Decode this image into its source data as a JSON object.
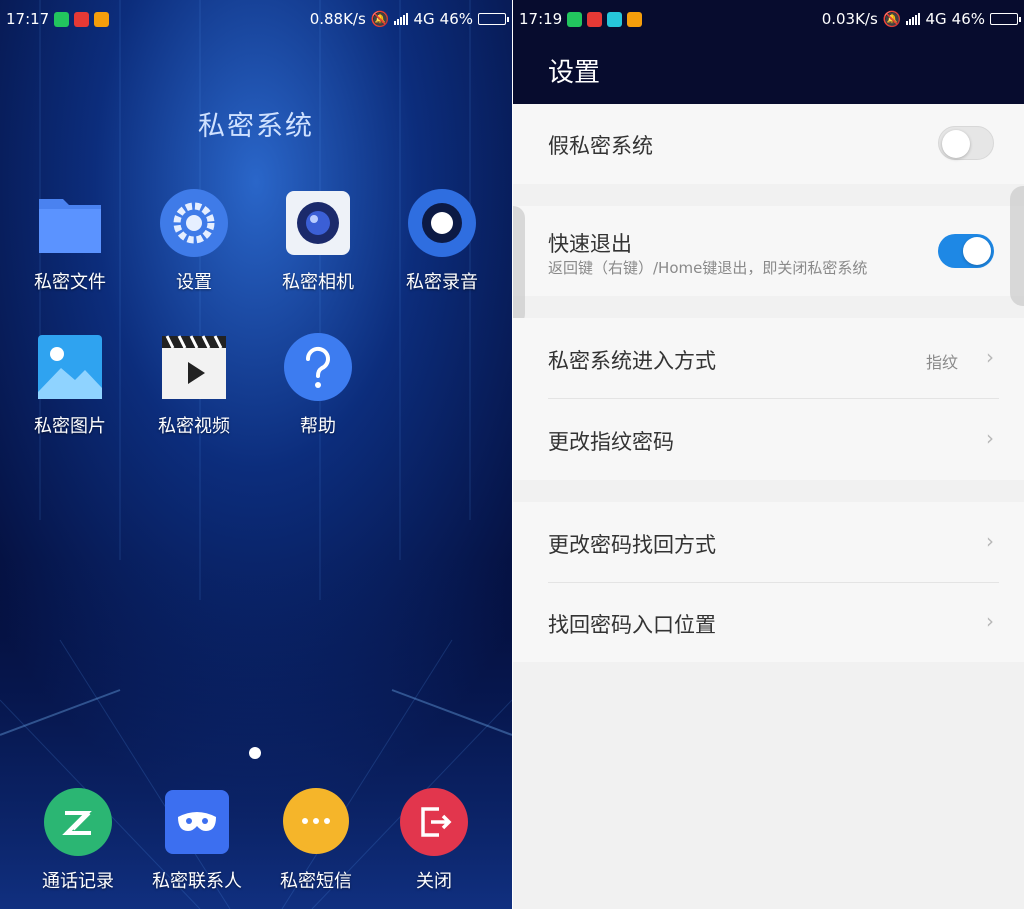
{
  "left": {
    "status": {
      "time": "17:17",
      "speed": "0.88K/s",
      "network": "4G",
      "battery": "46%"
    },
    "title": "私密系统",
    "apps": [
      {
        "label": "私密文件",
        "icon": "folder-icon"
      },
      {
        "label": "设置",
        "icon": "gear-icon"
      },
      {
        "label": "私密相机",
        "icon": "camera-icon"
      },
      {
        "label": "私密录音",
        "icon": "recorder-icon"
      },
      {
        "label": "私密图片",
        "icon": "picture-icon"
      },
      {
        "label": "私密视频",
        "icon": "video-icon"
      },
      {
        "label": "帮助",
        "icon": "help-icon"
      }
    ],
    "dock": [
      {
        "label": "通话记录",
        "icon": "call-log-icon"
      },
      {
        "label": "私密联系人",
        "icon": "mask-contacts-icon"
      },
      {
        "label": "私密短信",
        "icon": "message-icon"
      },
      {
        "label": "关闭",
        "icon": "exit-icon"
      }
    ]
  },
  "right": {
    "status": {
      "time": "17:19",
      "speed": "0.03K/s",
      "network": "4G",
      "battery": "46%"
    },
    "header_title": "设置",
    "rows": [
      {
        "title": "假私密系统",
        "toggle": false
      },
      {
        "title": "快速退出",
        "subtitle": "返回键（右键）/Home键退出，即关闭私密系统",
        "toggle": true
      },
      {
        "title": "私密系统进入方式",
        "value": "指纹"
      },
      {
        "title": "更改指纹密码"
      },
      {
        "title": "更改密码找回方式"
      },
      {
        "title": "找回密码入口位置"
      }
    ],
    "chevron": "›"
  },
  "colors": {
    "accent": "#1e88e5",
    "toggle_off": "#e6e6e6",
    "left_bg": "#061a55",
    "header_bg": "#070c2e",
    "battery_fill": "#5ed35e"
  }
}
